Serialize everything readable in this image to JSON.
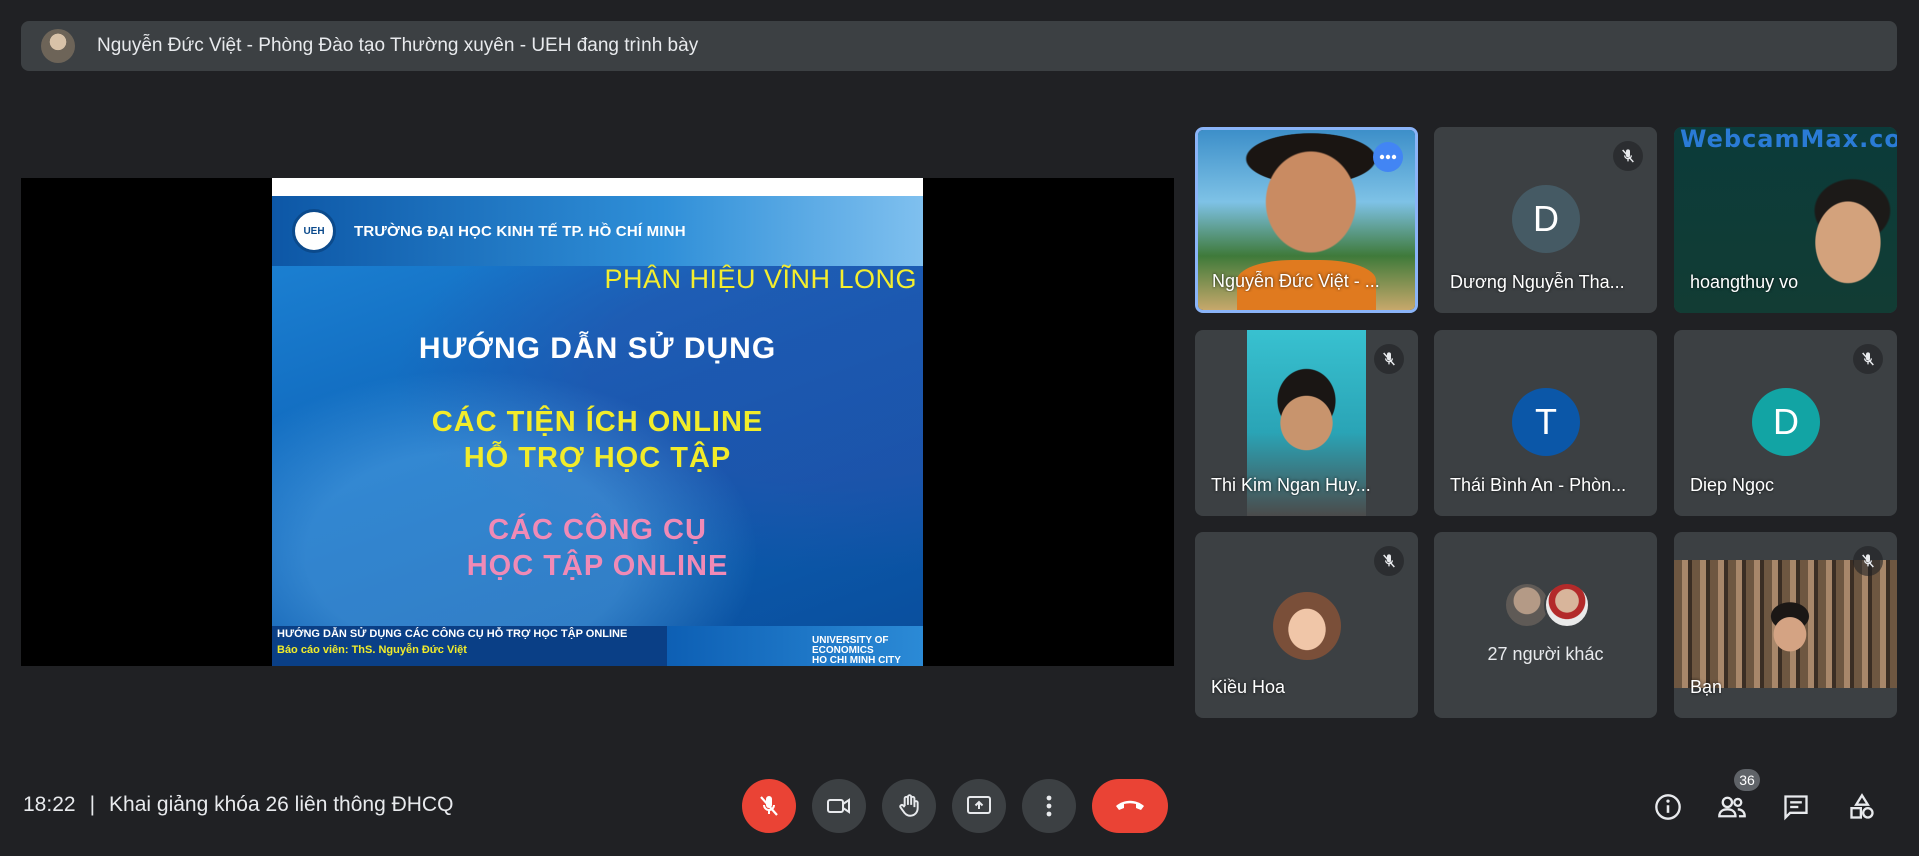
{
  "banner": {
    "text": "Nguyễn Đức Việt - Phòng Đào tạo Thường xuyên - UEH đang trình bày"
  },
  "slide": {
    "logo_text": "UEH",
    "school": "TRƯỜNG ĐẠI HỌC KINH TẾ TP. HỒ CHÍ MINH",
    "branch": "PHÂN HIỆU VĨNH LONG",
    "line1": "HƯỚNG DẪN SỬ DỤNG",
    "line2": "CÁC TIỆN ÍCH ONLINE",
    "line3": "HỖ TRỢ HỌC TẬP",
    "line4": "CÁC CÔNG CỤ",
    "line5": "HỌC TẬP ONLINE",
    "footer_line1": "HƯỚNG DẪN SỬ DỤNG CÁC CÔNG CỤ HỖ TRỢ HỌC TẬP ONLINE",
    "footer_line2": "Báo cáo viên: ThS. Nguyễn Đức Việt",
    "univ1": "UNIVERSITY OF",
    "univ2": "ECONOMICS",
    "univ3": "HO CHI MINH CITY"
  },
  "participants": [
    {
      "name": "Nguyễn Đức Việt - ...",
      "type": "video",
      "active": true
    },
    {
      "name": "Dương Nguyễn Tha...",
      "type": "letter",
      "letter": "D",
      "color": "#455a64",
      "muted": true
    },
    {
      "name": "hoangthuy vo",
      "type": "video",
      "overlay": "WebcamMax.co"
    },
    {
      "name": "Thi Kim Ngan Huy...",
      "type": "video",
      "muted": true
    },
    {
      "name": "Thái Bình An - Phòn...",
      "type": "letter",
      "letter": "T",
      "color": "#0b57a8"
    },
    {
      "name": "Diep Ngọc",
      "type": "letter",
      "letter": "D",
      "color": "#12a4a4",
      "muted": true
    },
    {
      "name": "Kiều Hoa",
      "type": "photo",
      "muted": true
    },
    {
      "name": "27 người khác",
      "type": "others"
    },
    {
      "name": "Bạn",
      "type": "video",
      "muted": true
    }
  ],
  "meeting": {
    "time": "18:22",
    "separator": "|",
    "title": "Khai giảng khóa 26 liên thông ĐHCQ",
    "people_count": "36"
  },
  "icons": {
    "mic": "mic-off-icon",
    "camera": "camera-icon",
    "hand": "raise-hand-icon",
    "present": "present-icon",
    "more": "more-vert-icon",
    "end": "call-end-icon",
    "info": "info-icon",
    "people": "people-icon",
    "chat": "chat-icon",
    "activities": "activities-icon"
  }
}
